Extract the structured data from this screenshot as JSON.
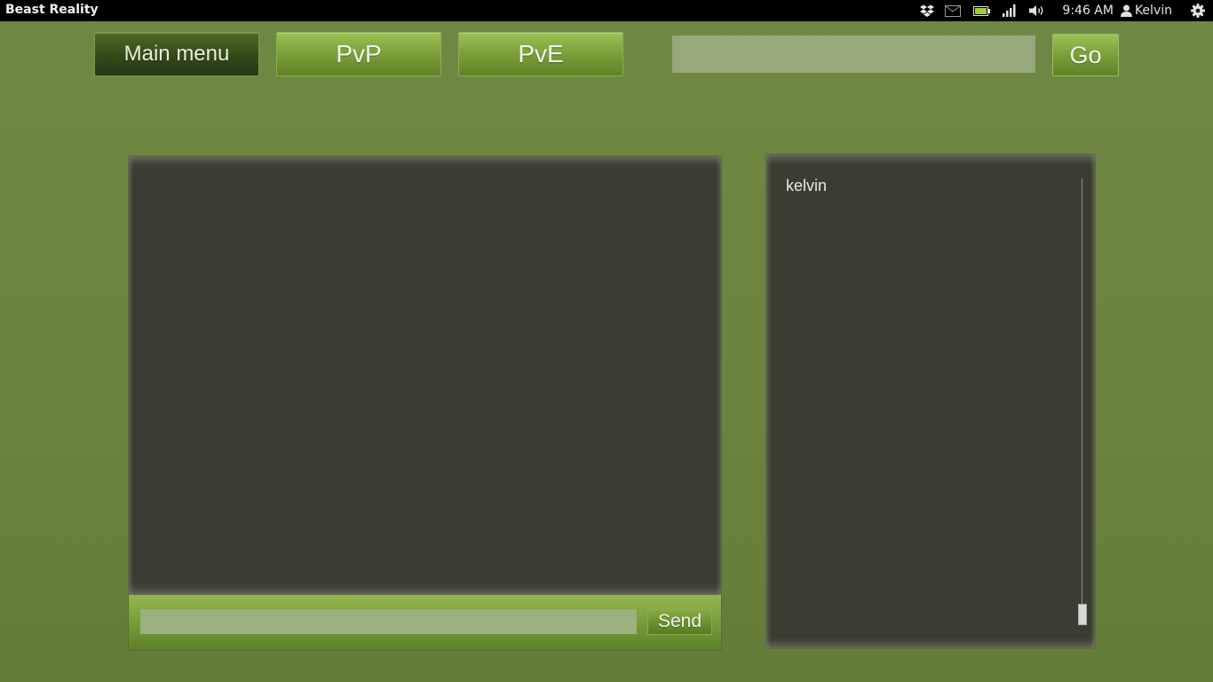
{
  "topbar": {
    "app_title": "Beast Reality",
    "clock": "9:46 AM",
    "user_name": "Kelvin",
    "icons": [
      "dropbox-icon",
      "mail-icon",
      "battery-icon",
      "signal-icon",
      "volume-icon",
      "user-icon",
      "gear-icon"
    ]
  },
  "nav": {
    "main_menu_label": "Main menu",
    "pvp_label": "PvP",
    "pve_label": "PvE",
    "search_value": "",
    "go_label": "Go"
  },
  "chat": {
    "messages": [],
    "input_value": "",
    "send_label": "Send"
  },
  "users": {
    "list": [
      "kelvin"
    ]
  },
  "colors": {
    "background": "#6f8844",
    "panel": "#3c3d32",
    "button_green": "#7ea23c",
    "active_button": "#34491a"
  }
}
